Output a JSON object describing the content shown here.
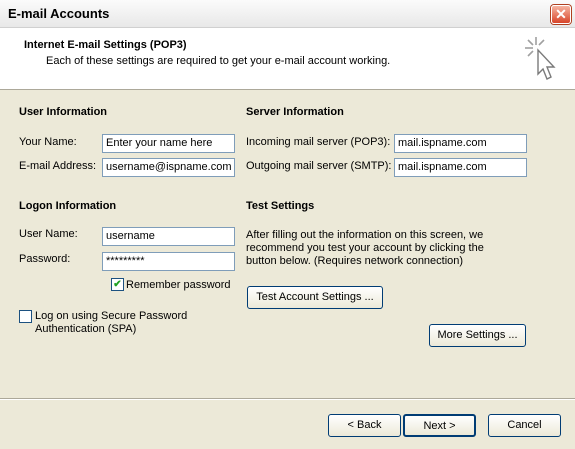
{
  "window": {
    "title": "E-mail Accounts",
    "close_glyph": "✕"
  },
  "header": {
    "title": "Internet E-mail Settings (POP3)",
    "subtitle": "Each of these settings are required to get your e-mail account working.",
    "icon": "wizard-cursor-icon"
  },
  "user_info": {
    "heading": "User Information",
    "name_label": "Your Name:",
    "name_value": "Enter your name here",
    "email_label": "E-mail Address:",
    "email_value": "username@ispname.com"
  },
  "server_info": {
    "heading": "Server Information",
    "incoming_label": "Incoming mail server (POP3):",
    "incoming_value": "mail.ispname.com",
    "outgoing_label": "Outgoing mail server (SMTP):",
    "outgoing_value": "mail.ispname.com"
  },
  "logon_info": {
    "heading": "Logon Information",
    "user_label": "User Name:",
    "user_value": "username",
    "password_label": "Password:",
    "password_value": "*********",
    "remember_label": "Remember password",
    "remember_checked": true,
    "spa_label_line1": "Log on using Secure Password",
    "spa_label_line2": "Authentication (SPA)",
    "spa_checked": false
  },
  "test_settings": {
    "heading": "Test Settings",
    "desc_line1": "After filling out the information on this screen, we",
    "desc_line2": "recommend you test your account by clicking the",
    "desc_line3": "button below. (Requires network connection)",
    "test_button": "Test Account Settings ..."
  },
  "more_settings_button": "More Settings ...",
  "footer": {
    "back": "< Back",
    "next": "Next >",
    "cancel": "Cancel"
  }
}
